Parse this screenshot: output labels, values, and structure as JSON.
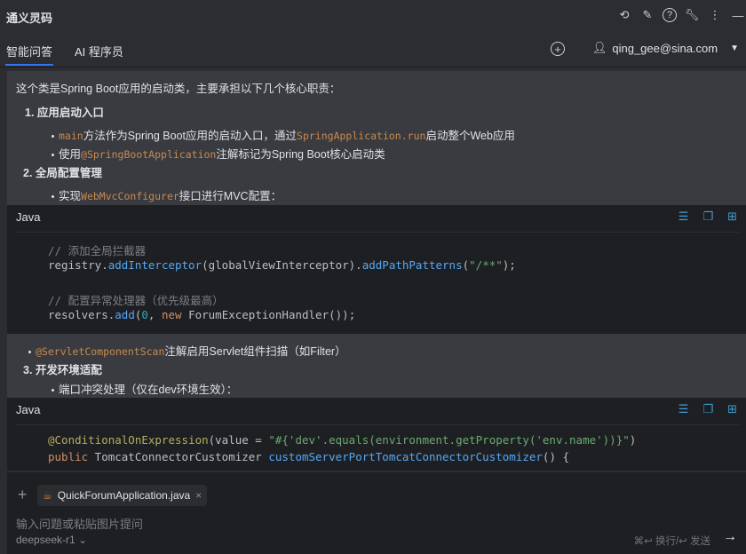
{
  "header": {
    "title": "通义灵码",
    "icons": [
      "history-icon",
      "edit-icon",
      "help-icon",
      "wrench-icon",
      "more-icon",
      "minimize-icon"
    ]
  },
  "tabs": [
    {
      "label": "智能问答",
      "active": true
    },
    {
      "label": "AI 程序员",
      "active": false
    }
  ],
  "user": {
    "email": "qing_gee@sina.com"
  },
  "message": {
    "intro": "这个类是Spring Boot应用的启动类，主要承担以下几个核心职责：",
    "s1": "1. 应用启动入口",
    "s1b1": {
      "c1": "main",
      "t1": "方法作为Spring Boot应用的启动入口，通过",
      "c2": "SpringApplication.run",
      "t2": "启动整个Web应用"
    },
    "s1b2": {
      "t0": "使用",
      "c1": "@SpringBootApplication",
      "t1": "注解标记为Spring Boot核心启动类"
    },
    "s2": "2. 全局配置管理",
    "s2b1": {
      "t0": "实现",
      "c1": "WebMvcConfigurer",
      "t1": "接口进行MVC配置："
    },
    "s2b2": {
      "c1": "@ServletComponentScan",
      "t1": "注解启用Servlet组件扫描（如Filter）"
    },
    "s3": "3. 开发环境适配",
    "s3b1": "端口冲突处理（仅在dev环境生效）："
  },
  "code1": {
    "lang": "Java",
    "lines": {
      "c1": "// 添加全局拦截器",
      "l2a": "registry.",
      "l2b": "addInterceptor",
      "l2c": "(globalViewInterceptor).",
      "l2d": "addPathPatterns",
      "l2e": "(",
      "l2f": "\"/**\"",
      "l2g": ");",
      "c2": "// 配置异常处理器（优先级最高）",
      "l5a": "resolvers.",
      "l5b": "add",
      "l5c": "(",
      "l5d": "0",
      "l5e": ", ",
      "l5f": "new",
      "l5g": " ForumExceptionHandler());"
    }
  },
  "code2": {
    "lang": "Java",
    "lines": {
      "l1a": "@ConditionalOnExpression",
      "l1b": "(value = ",
      "l1c": "\"#{'dev'.equals(environment.getProperty('env.name'))}\"",
      "l1d": ")",
      "l2a": "public",
      "l2b": " TomcatConnectorCustomizer ",
      "l2c": "customServerPortTomcatConnectorCustomizer",
      "l2d": "() {"
    }
  },
  "input": {
    "file_chip": "QuickForumApplication.java",
    "placeholder": "输入问题或粘贴图片提问",
    "model": "deepseek-r1",
    "hint": "⌘↩ 换行/↩ 发送"
  }
}
